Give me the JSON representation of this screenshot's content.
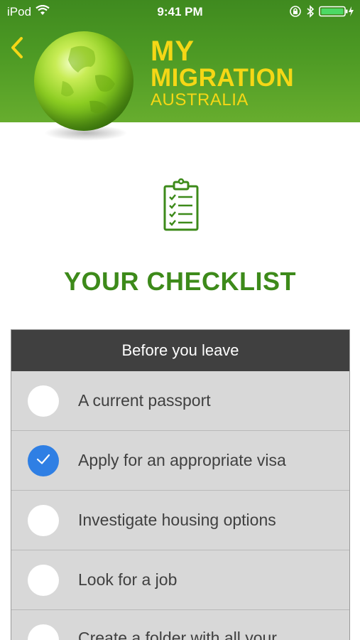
{
  "status_bar": {
    "carrier": "iPod",
    "time": "9:41 PM"
  },
  "icons": {
    "back": "back-chevron-icon",
    "wifi": "wifi-icon",
    "orientation_lock": "orientation-lock-icon",
    "bluetooth": "bluetooth-icon",
    "battery": "battery-charging-icon",
    "checklist": "clipboard-checklist-icon",
    "check": "checkmark-icon"
  },
  "brand": {
    "line1": "MY",
    "line2": "MIGRATION",
    "line3": "AUSTRALIA"
  },
  "colors": {
    "header_green": "#4d9a24",
    "brand_yellow": "#f5d716",
    "title_green": "#3d8a1a",
    "section_header": "#404040",
    "checked_blue": "#2f7fe4"
  },
  "page": {
    "title": "YOUR CHECKLIST"
  },
  "checklist": {
    "section_title": "Before you leave",
    "items": [
      {
        "label": "A current passport",
        "checked": false
      },
      {
        "label": "Apply for an appropriate visa",
        "checked": true
      },
      {
        "label": "Investigate housing options",
        "checked": false
      },
      {
        "label": "Look for a job",
        "checked": false
      },
      {
        "label": "Create a folder with all your",
        "checked": false
      }
    ]
  }
}
